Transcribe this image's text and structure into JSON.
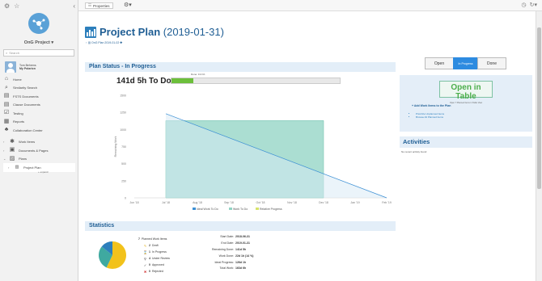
{
  "sidebar": {
    "project": "OnG Project",
    "search_placeholder": "Search",
    "user": {
      "name": "Tom Behrens",
      "subtitle": "My Polarion"
    },
    "nav": [
      {
        "id": "home",
        "label": "Home",
        "icon": "home-icon"
      },
      {
        "id": "similarity",
        "label": "Similarity Search",
        "icon": "search-icon"
      },
      {
        "id": "fsts",
        "label": "FSTS Documents",
        "icon": "documents-icon"
      },
      {
        "id": "clause",
        "label": "Clause Documents",
        "icon": "documents-icon"
      },
      {
        "id": "testing",
        "label": "Testing",
        "icon": "checkbox-icon"
      },
      {
        "id": "reports",
        "label": "Reports",
        "icon": "report-icon"
      },
      {
        "id": "collab",
        "label": "Collaboration Center",
        "icon": "collaboration-icon"
      }
    ],
    "tree": [
      {
        "id": "workitems",
        "label": "Work Items",
        "icon": "work-items-icon"
      },
      {
        "id": "docs",
        "label": "Documents & Pages",
        "icon": "pages-icon"
      },
      {
        "id": "plans",
        "label": "Plans",
        "icon": "plans-icon"
      }
    ],
    "active_item": "Project Plan",
    "expand_label": "+ expand"
  },
  "topbar": {
    "properties_label": "Properties"
  },
  "page": {
    "title_bold": "Project Plan",
    "title_dates": "(2019-01-31)",
    "subtitle": "OnG Plan 2019-01-02"
  },
  "status": {
    "heading": "Plan Status - In Progress",
    "todo": "141d 5h To Do",
    "progress_label": "Done: 13.1%",
    "progress": 0.131
  },
  "chart_data": {
    "type": "area",
    "x_ticks": [
      "Jun '18",
      "Jul '18",
      "Aug '18",
      "Sep '18",
      "Oct '18",
      "Nov '18",
      "Dec '18",
      "Jan '19",
      "Feb '19"
    ],
    "ylabel": "Remaining Work",
    "yticks": [
      0,
      250,
      500,
      750,
      1000,
      1250,
      1500
    ],
    "ylim": [
      0,
      1500
    ],
    "series": [
      {
        "name": "Ideal Work To Do",
        "color": "#3b8fd4",
        "points": [
          [
            "Jul '18",
            1230
          ],
          [
            "Feb '19",
            0
          ]
        ]
      },
      {
        "name": "Work To Do",
        "color": "#8fd3c3",
        "points": [
          [
            "Jul '18",
            1130
          ],
          [
            "Jul '18",
            1130
          ],
          [
            "Dec '18",
            1130
          ]
        ]
      },
      {
        "name": "Relative Progress",
        "color": "#d7e36a",
        "points": []
      }
    ],
    "legend": "bottom",
    "grid": false
  },
  "right_panel": {
    "segments": [
      "Open",
      "In Progress",
      "Done"
    ],
    "active_segment": 1,
    "open_table": "Open in Table",
    "open_table_sub": "Open 7 Planned Items in Table View",
    "add_items": "+ Add Work Items to the Plan",
    "links": [
      "Prioritize Unplanned Items",
      "Browse All Planned Items"
    ],
    "activities_title": "Activities",
    "no_activity": "No recent activity found"
  },
  "statistics": {
    "heading": "Statistics",
    "planned": "7 Planned Work Items",
    "planned_count": "7",
    "planned_label": "Planned Work Items",
    "items": [
      {
        "count": "2",
        "label": "Draft",
        "icon": "pencil-icon",
        "color": "#e0b020"
      },
      {
        "count": "1",
        "label": "In Progress",
        "icon": "hourglass-icon",
        "color": "#777777"
      },
      {
        "count": "4",
        "label": "Under Review",
        "icon": "review-icon",
        "color": "#777777"
      },
      {
        "count": "0",
        "label": "Approved",
        "icon": "check-icon",
        "color": "#333333"
      },
      {
        "count": "0",
        "label": "Rejected",
        "icon": "x-icon",
        "color": "#d03030"
      }
    ],
    "pie": [
      {
        "value": 4,
        "color": "#f2c21b"
      },
      {
        "value": 2,
        "color": "#3fa9a0"
      },
      {
        "value": 1,
        "color": "#2d7fbc"
      }
    ],
    "dates": [
      {
        "k": "Start Date:",
        "v": "2018-06-31"
      },
      {
        "k": "End Date:",
        "v": "2019-01-31"
      },
      {
        "k": "Remaining Done:",
        "v": "141d 5h"
      },
      {
        "k": "Work Done:",
        "v": "22d 1h (14 %)"
      },
      {
        "k": "Ideal Progress:",
        "v": "126d 1h"
      },
      {
        "k": "Total Work:",
        "v": "163d 6h"
      }
    ]
  }
}
